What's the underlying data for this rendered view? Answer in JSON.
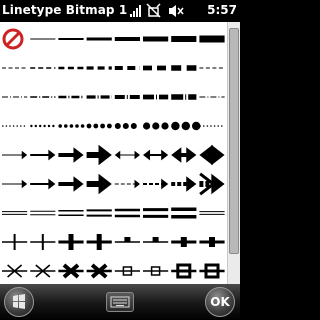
{
  "app": {
    "title": "Linetype Bitmap 1"
  },
  "status": {
    "time": "5:57"
  },
  "softkeys": {
    "ok_label": "OK"
  },
  "icons": {
    "start": "windows-flag-icon",
    "keyboard": "keyboard-icon",
    "status": [
      "signal-strength-icon",
      "data-connection-icon",
      "volume-mute-icon"
    ]
  },
  "linetypes": {
    "rows": [
      {
        "kind": "solid",
        "weights": [
          0,
          1,
          2,
          3,
          4,
          5,
          6
        ]
      },
      {
        "kind": "dash",
        "weights": [
          1,
          2,
          3,
          4,
          5,
          6,
          7
        ]
      },
      {
        "kind": "dashdot",
        "weights": [
          1,
          2,
          3,
          4,
          5,
          6,
          7
        ]
      },
      {
        "kind": "dots",
        "weights": [
          1,
          2,
          3,
          4,
          5,
          6,
          7
        ]
      },
      {
        "kind": "arrow",
        "variants": [
          "thin",
          "medium",
          "bold",
          "heavy",
          "double-thin",
          "double-medium",
          "double-bold",
          "double-heavy"
        ]
      },
      {
        "kind": "arrow-dashed",
        "variants": [
          "thin",
          "medium",
          "bold",
          "heavy",
          "thin-tail",
          "medium-tail",
          "bold-tail",
          "chevron"
        ]
      },
      {
        "kind": "double-line",
        "weights": [
          1,
          2,
          3,
          4,
          5,
          6,
          7
        ]
      },
      {
        "kind": "tick-cross",
        "variants": [
          "plus",
          "plus",
          "plus-bold",
          "plus-bold",
          "tee",
          "tee",
          "tee-bold",
          "tee-bold"
        ]
      },
      {
        "kind": "x-box",
        "variants": [
          "x",
          "x",
          "x-bold",
          "x-bold",
          "box",
          "box",
          "box-bold",
          "box-bold"
        ]
      }
    ]
  },
  "colors": {
    "selection": "#cc2222",
    "stroke": "#000000"
  }
}
